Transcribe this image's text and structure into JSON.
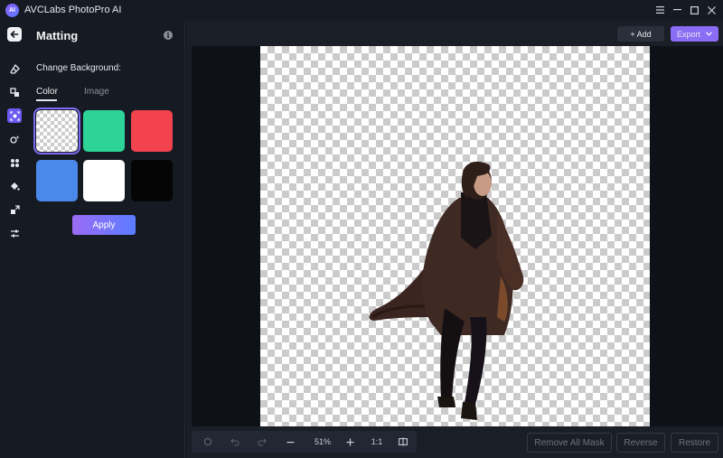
{
  "app": {
    "title": "AVCLabs PhotoPro AI",
    "logo_text": "AI",
    "window_controls": [
      "menu-icon",
      "minimize-icon",
      "maximize-icon",
      "close-icon"
    ]
  },
  "rail": {
    "items": [
      {
        "name": "eraser-icon",
        "active": false
      },
      {
        "name": "object-remove-icon",
        "active": false
      },
      {
        "name": "matting-icon",
        "active": true
      },
      {
        "name": "face-enhance-icon",
        "active": false
      },
      {
        "name": "colorize-icon",
        "active": false
      },
      {
        "name": "paint-bucket-icon",
        "active": false
      },
      {
        "name": "upscale-icon",
        "active": false
      },
      {
        "name": "adjust-sliders-icon",
        "active": false
      }
    ]
  },
  "panel": {
    "title": "Matting",
    "section_label": "Change Background:",
    "tabs": [
      {
        "label": "Color",
        "active": true
      },
      {
        "label": "Image",
        "active": false
      }
    ],
    "swatches": [
      {
        "color": "transparent",
        "selected": true
      },
      {
        "color": "#2ed497",
        "selected": false
      },
      {
        "color": "#f2434f",
        "selected": false
      },
      {
        "color": "#4a89ea",
        "selected": false
      },
      {
        "color": "#ffffff",
        "selected": false
      },
      {
        "color": "#050505",
        "selected": false
      }
    ],
    "apply_label": "Apply"
  },
  "toolbar": {
    "add_label": "+ Add",
    "export_label": "Export"
  },
  "bottom": {
    "zoom": "51%",
    "ratio_label": "1:1",
    "remove_all_mask_label": "Remove All Mask",
    "reverse_label": "Reverse",
    "restore_label": "Restore"
  },
  "colors": {
    "accent": "#7c6cf5",
    "background": "#11151c",
    "panel": "#161a22"
  }
}
